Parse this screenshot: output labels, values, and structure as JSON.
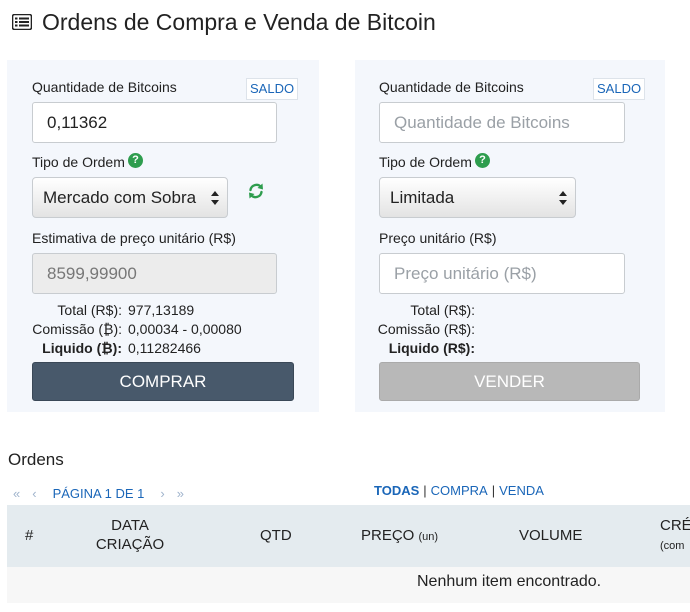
{
  "page": {
    "title": "Ordens de Compra e Venda de Bitcoin",
    "title_icon": "list-icon"
  },
  "buy_panel": {
    "qty_label": "Quantidade de Bitcoins",
    "saldo_label": "SALDO",
    "qty_value": "0,11362",
    "order_type_label": "Tipo de Ordem",
    "help_glyph": "?",
    "order_type_value": "Mercado com Sobra",
    "price_label": "Estimativa de preço unitário (R$)",
    "price_value": "8599,99900",
    "summary": [
      {
        "key": "Total (R$):",
        "value": "977,13189",
        "bold": false
      },
      {
        "key": "Comissão (₿):",
        "value": "0,00034 - 0,00080",
        "bold": false
      },
      {
        "key": "Liquido (₿):",
        "value": "0,11282466",
        "bold": true
      }
    ],
    "button_label": "COMPRAR"
  },
  "sell_panel": {
    "qty_label": "Quantidade de Bitcoins",
    "saldo_label": "SALDO",
    "qty_placeholder": "Quantidade de Bitcoins",
    "order_type_label": "Tipo de Ordem",
    "help_glyph": "?",
    "order_type_value": "Limitada",
    "price_label": "Preço unitário (R$)",
    "price_placeholder": "Preço unitário (R$)",
    "summary": [
      {
        "key": "Total (R$):",
        "value": "",
        "bold": false
      },
      {
        "key": "Comissão (R$):",
        "value": "",
        "bold": false
      },
      {
        "key": "Liquido (R$):",
        "value": "",
        "bold": true
      }
    ],
    "button_label": "VENDER"
  },
  "orders": {
    "title": "Ordens",
    "pagination": {
      "label": "PÁGINA 1 DE 1",
      "first_glyph": "«",
      "prev_glyph": "‹",
      "next_glyph": "›",
      "last_glyph": "»"
    },
    "filter": {
      "all": "TODAS",
      "buy": "COMPRA",
      "sell": "VENDA",
      "separator": "|"
    },
    "columns": [
      {
        "label": "#",
        "sub": ""
      },
      {
        "label": "DATA",
        "sub": "CRIAÇÃO"
      },
      {
        "label": "QTD",
        "sub": ""
      },
      {
        "label": "PREÇO",
        "sub": "(un)"
      },
      {
        "label": "VOLUME",
        "sub": ""
      },
      {
        "label": "CRÉ",
        "sub": "(com"
      }
    ],
    "empty_message": "Nenhum item encontrado."
  },
  "colors": {
    "accent": "#1a66b8",
    "buy_button": "#48596b",
    "sell_button_disabled": "#b8b8b8",
    "help_icon": "#2e9d4e",
    "panel_bg": "#f4f7fc",
    "table_header_bg": "#e4ebef"
  }
}
